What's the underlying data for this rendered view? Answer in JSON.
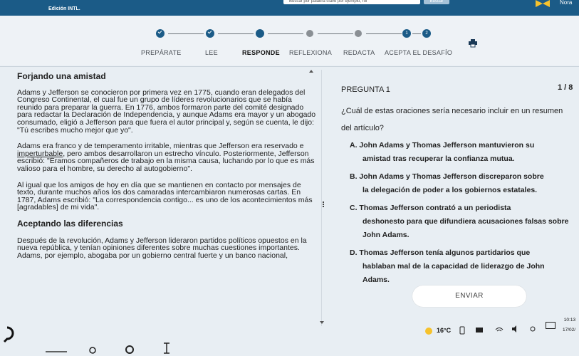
{
  "header": {
    "edition": "Edición INTL.",
    "search_placeholder": "Buscar por palabra clave por ejemplo, rol",
    "search_button": "Buscar",
    "user": "Nora"
  },
  "steps": [
    {
      "label": "PREPÁRATE",
      "state": "done"
    },
    {
      "label": "LEE",
      "state": "done"
    },
    {
      "label": "RESPONDE",
      "state": "current"
    },
    {
      "label": "REFLEXIONA",
      "state": "todo"
    },
    {
      "label": "REDACTA",
      "state": "todo"
    },
    {
      "label": "ACEPTA EL DESAFÍO",
      "state": "todo"
    }
  ],
  "challenge_badges": [
    "1",
    "2"
  ],
  "passage": {
    "title": "Forjando una amistad",
    "p1": "Adams y Jefferson se conocieron por primera vez en 1775, cuando eran delegados del Congreso Continental, el cual fue un grupo de líderes revolucionarios que se había reunido para preparar la guerra. En 1776, ambos formaron parte del comité designado para redactar la Declaración de Independencia, y aunque Adams era mayor y un abogado consumado, eligió a Jefferson para que fuera el autor principal y, según se cuenta, le dijo: \"Tú escribes mucho mejor que yo\".",
    "p2_a": "Adams era franco y de temperamento irritable, mientras que Jefferson era reservado e ",
    "p2_link": "imperturbable",
    "p2_b": ", pero ambos desarrollaron un estrecho vínculo. Posteriormente, Jefferson escribió: \"Éramos compañeros de trabajo en la misma causa, luchando por lo que es más valioso para el hombre, su derecho al autogobierno\".",
    "p3": "Al igual que los amigos de hoy en día que se mantienen en contacto por mensajes de texto, durante muchos años los dos camaradas intercambiaron numerosas cartas. En 1787, Adams escribió: \"La correspondencia contigo... es uno de los acontecimientos más [agradables] de mi vida\".",
    "subtitle": "Aceptando las diferencias",
    "p4": "Después de la revolución, Adams y Jefferson lideraron partidos políticos opuestos en la nueva república, y tenían opiniones diferentes sobre muchas cuestiones importantes. Adams, por ejemplo, abogaba por un gobierno central fuerte y un banco nacional,"
  },
  "question": {
    "label": "PREGUNTA 1",
    "counter": "1 / 8",
    "text": "¿Cuál de estas oraciones sería necesario incluir en un resumen del artículo?",
    "choices": [
      {
        "letter": "A.",
        "line1": "John Adams y Thomas Jefferson mantuvieron su",
        "line2": "amistad tras recuperar la confianza mutua."
      },
      {
        "letter": "B.",
        "line1": "John Adams y Thomas Jefferson discreparon sobre",
        "line2": "la delegación de poder a los gobiernos estatales."
      },
      {
        "letter": "C.",
        "line1": "Thomas Jefferson contrató a un periodista",
        "line2": "deshonesto para que difundiera acusaciones falsas sobre John Adams."
      },
      {
        "letter": "D.",
        "line1": "Thomas Jefferson tenía algunos partidarios que",
        "line2": "hablaban mal de la capacidad de liderazgo de John Adams."
      }
    ],
    "submit": "ENVIAR"
  },
  "taskbar": {
    "weather": "16°C",
    "time": "10:13",
    "date": "17/02/"
  }
}
